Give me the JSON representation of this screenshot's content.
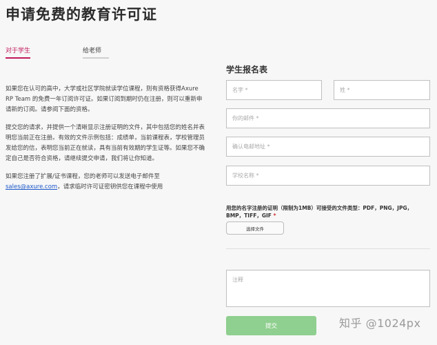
{
  "header": {
    "title": "申请免费的教育许可证"
  },
  "tabs": [
    {
      "label": "对于学生",
      "active": true
    },
    {
      "label": "给老师",
      "active": false
    }
  ],
  "info": {
    "p1": "如果您在认可的高中，大学或社区学院就读学位课程，则有资格获得Axure RP Team 的免费一年订阅许可证。如果订阅到期时仍在注册，则可以重新申请新的订阅。请参阅下面的资格。",
    "p2": "提交您的请求，并提供一个清晰显示注册证明的文件，其中包括您的姓名并表明您当前正在注册。有效的文件示例包括：成绩单，当前课程表，学校管理员发给您的信，表明您当前正在就读，具有当前有效期的学生证等。如果您不确定自己是否符合资格，请继续提交申请，我们将让你知道。",
    "p3_before": "如果您注册了扩展/证书课程，您的老师可以发送电子邮件至",
    "p3_link": "sales@axure.com",
    "p3_after": "，请求临时许可证密钥供您在课程中使用"
  },
  "form": {
    "title": "学生报名表",
    "first_name": "名字",
    "last_name": "姓",
    "email": "你的邮件",
    "confirm_email": "确认电邮地址",
    "school": "学校名称",
    "required_mark": "*",
    "upload_label": "用您的名字注册的证明（限制为1MB）可接受的文件类型：PDF，PNG，JPG，BMP，TIFF，GIF",
    "upload_required": "*",
    "choose_file": "选择文件",
    "notes": "注释",
    "submit": "提交"
  },
  "watermark": "知乎 @1024px"
}
